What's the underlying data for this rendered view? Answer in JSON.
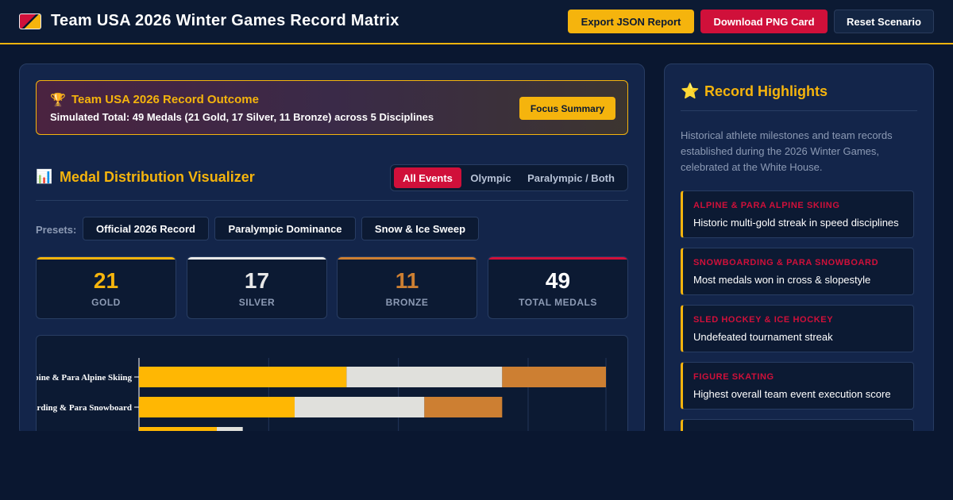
{
  "header": {
    "title": "Team USA 2026 Winter Games Record Matrix",
    "buttons": {
      "export": "Export JSON Report",
      "download": "Download PNG Card",
      "reset": "Reset Scenario"
    }
  },
  "summary": {
    "title": "Team USA 2026 Record Outcome",
    "text": "Simulated Total: 49 Medals (21 Gold, 17 Silver, 11 Bronze) across 5 Disciplines",
    "focus_button": "Focus Summary"
  },
  "visualizer": {
    "title": "Medal Distribution Visualizer",
    "tabs": [
      "All Events",
      "Olympic",
      "Paralympic / Both"
    ],
    "active_tab": "All Events"
  },
  "presets": {
    "label": "Presets:",
    "items": [
      "Official 2026 Record",
      "Paralympic Dominance",
      "Snow & Ice Sweep"
    ]
  },
  "stats": [
    {
      "value": "21",
      "label": "GOLD",
      "color": "#f5b40d"
    },
    {
      "value": "17",
      "label": "SILVER",
      "color": "#e8e8e8"
    },
    {
      "value": "11",
      "label": "BRONZE",
      "color": "#cd7f32"
    },
    {
      "value": "49",
      "label": "TOTAL MEDALS",
      "color": "#d0103a"
    }
  ],
  "chart_data": {
    "type": "bar",
    "orientation": "horizontal",
    "stacked": true,
    "categories": [
      "Alpine & Para Alpine Skiing",
      "Snowboarding & Para Snowboard",
      ""
    ],
    "series": [
      {
        "name": "Gold",
        "color": "#ffb703",
        "values": [
          8,
          6,
          3
        ]
      },
      {
        "name": "Silver",
        "color": "#e0e0dc",
        "values": [
          6,
          5,
          1
        ]
      },
      {
        "name": "Bronze",
        "color": "#cd7f32",
        "values": [
          4,
          3,
          0
        ]
      }
    ],
    "xlim": [
      0,
      18
    ],
    "grid": true
  },
  "side": {
    "title": "Record Highlights",
    "description": "Historical athlete milestones and team records established during the 2026 Winter Games, celebrated at the White House.",
    "highlights": [
      {
        "category": "ALPINE & PARA ALPINE SKIING",
        "text": "Historic multi-gold streak in speed disciplines"
      },
      {
        "category": "SNOWBOARDING & PARA SNOWBOARD",
        "text": "Most medals won in cross & slopestyle"
      },
      {
        "category": "SLED HOCKEY & ICE HOCKEY",
        "text": "Undefeated tournament streak"
      },
      {
        "category": "FIGURE SKATING",
        "text": "Highest overall team event execution score"
      },
      {
        "category": "",
        "text": ""
      }
    ]
  },
  "colors": {
    "background": "#0a1730",
    "panel": "#13254a",
    "accent_gold": "#f5b40d",
    "accent_red": "#d0103a"
  }
}
